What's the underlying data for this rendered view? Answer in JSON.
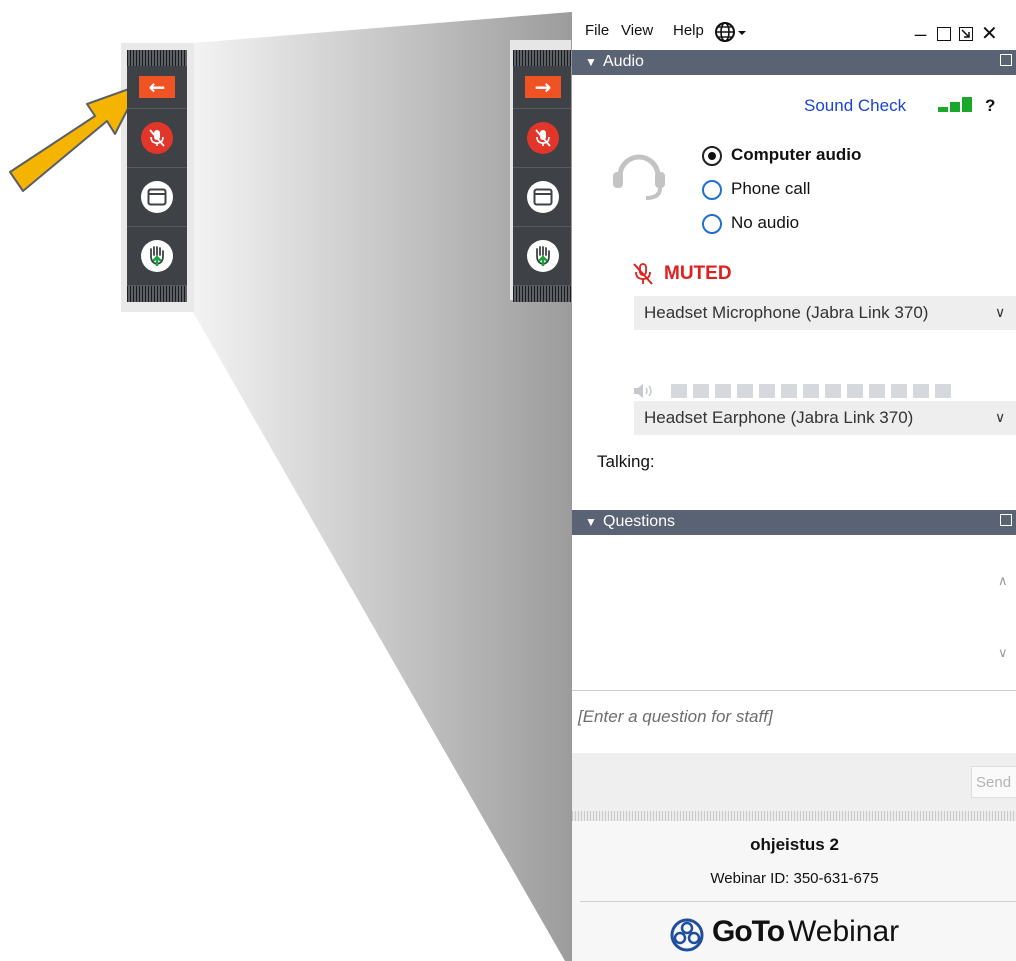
{
  "window": {
    "menu": [
      "File",
      "View",
      "Help"
    ],
    "controls": {
      "minimize": "_",
      "close": "✕"
    }
  },
  "audio": {
    "section_title": "Audio",
    "sound_check": "Sound Check",
    "help": "?",
    "options": [
      {
        "label": "Computer audio",
        "selected": true
      },
      {
        "label": "Phone call",
        "selected": false
      },
      {
        "label": "No audio",
        "selected": false
      }
    ],
    "status": "MUTED",
    "microphone": "Headset Microphone (Jabra Link 370)",
    "speaker": "Headset Earphone (Jabra Link 370)",
    "talking_label": "Talking:",
    "speaker_level": 0
  },
  "questions": {
    "section_title": "Questions",
    "placeholder": "[Enter a question for staff]",
    "send_label": "Send"
  },
  "footer": {
    "webinar_title": "ohjeistus 2",
    "webinar_id": "Webinar ID: 350-631-675",
    "brand_bold": "GoTo",
    "brand_light": "Webinar"
  },
  "colors": {
    "toolbar_bg": "#3e4145",
    "collapse_arrow": "#f05323",
    "muted_red": "#e02020",
    "section_header": "#5a6374",
    "link_blue": "#1a44d4",
    "signal_green": "#19a82c",
    "pointer_arrow": "#f4b400"
  },
  "icons": {
    "collapse_left": "arrow-left-icon",
    "expand_right": "arrow-right-icon",
    "microphone_muted": "microphone-muted-icon",
    "screen": "window-icon",
    "raise_hand": "raise-hand-icon",
    "headset": "headset-icon",
    "language": "globe-icon",
    "speaker": "speaker-icon",
    "logo": "gotowebinar-logo-icon",
    "pointer": "pointer-arrow-icon"
  }
}
